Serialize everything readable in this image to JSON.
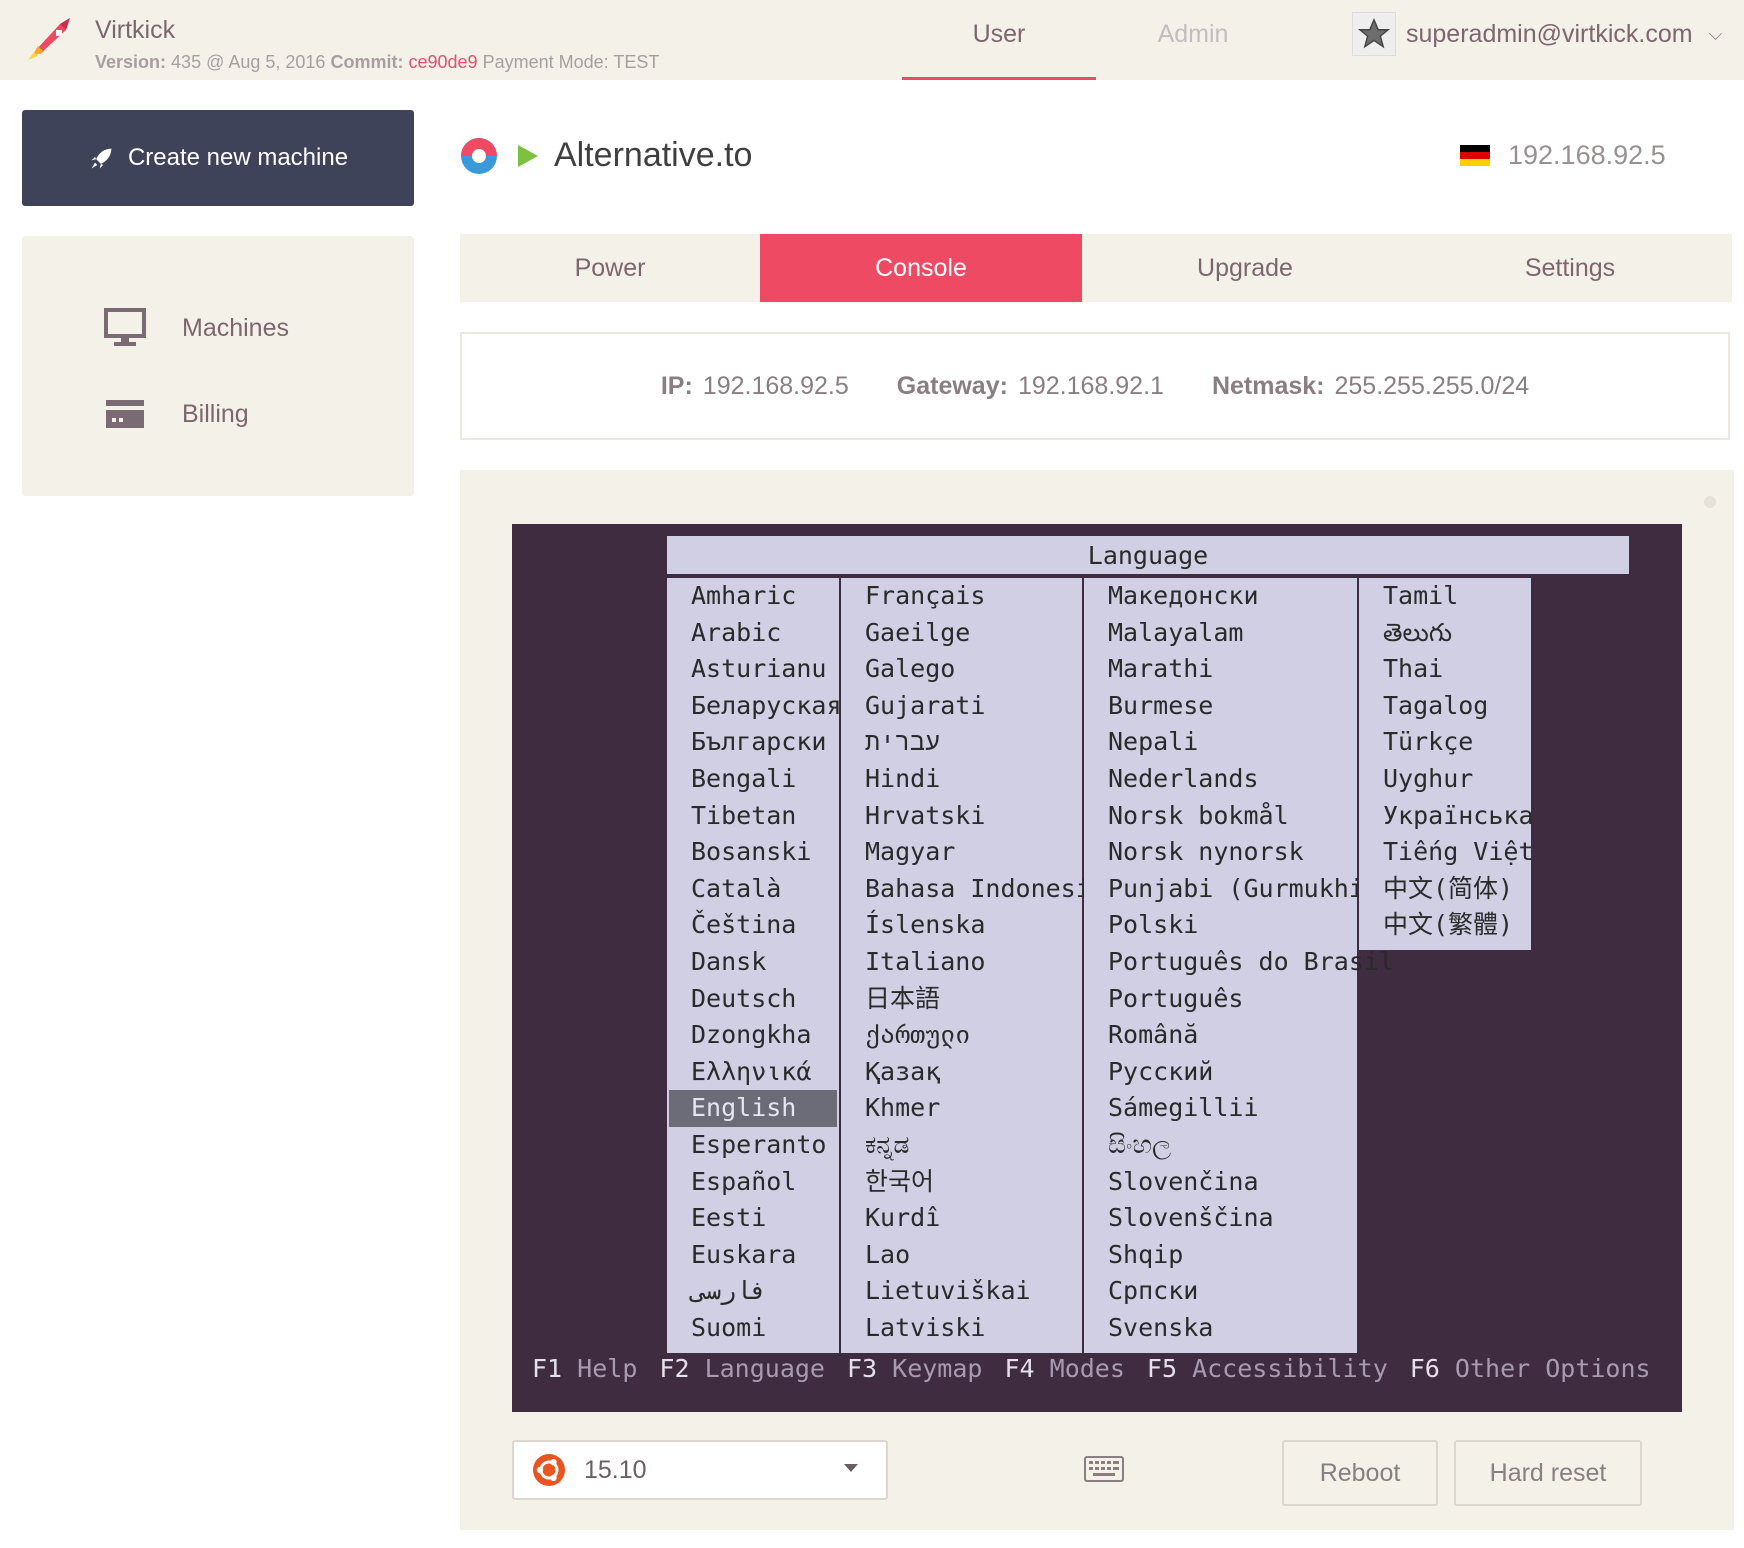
{
  "header": {
    "brand": "Virtkick",
    "version_label": "Version:",
    "version_value": "435 @ Aug 5, 2016",
    "commit_label": "Commit:",
    "commit_value": "ce90de9",
    "payment_label": "Payment Mode:",
    "payment_value": "TEST",
    "nav": [
      {
        "label": "User",
        "active": true
      },
      {
        "label": "Admin",
        "active": false
      }
    ],
    "user_email": "superadmin@virtkick.com"
  },
  "sidebar": {
    "create_label": "Create new machine",
    "items": [
      {
        "label": "Machines",
        "icon": "monitor-icon"
      },
      {
        "label": "Billing",
        "icon": "credit-card-icon"
      }
    ]
  },
  "machine": {
    "name": "Alternative.to",
    "ip": "192.168.92.5",
    "status_color": "#7dc142"
  },
  "tabs": [
    {
      "label": "Power",
      "active": false
    },
    {
      "label": "Console",
      "active": true
    },
    {
      "label": "Upgrade",
      "active": false
    },
    {
      "label": "Settings",
      "active": false
    }
  ],
  "network": {
    "ip_label": "IP:",
    "ip_value": "192.168.92.5",
    "gateway_label": "Gateway:",
    "gateway_value": "192.168.92.1",
    "netmask_label": "Netmask:",
    "netmask_value": "255.255.255.0/24"
  },
  "console": {
    "title": "Language",
    "selected": "English",
    "columns": [
      [
        "Amharic",
        "Arabic",
        "Asturianu",
        "Беларуская",
        "Български",
        "Bengali",
        "Tibetan",
        "Bosanski",
        "Català",
        "Čeština",
        "Dansk",
        "Deutsch",
        "Dzongkha",
        "Ελληνικά",
        "English",
        "Esperanto",
        "Español",
        "Eesti",
        "Euskara",
        "فارسی",
        "Suomi"
      ],
      [
        "Français",
        "Gaeilge",
        "Galego",
        "Gujarati",
        "עברית",
        "Hindi",
        "Hrvatski",
        "Magyar",
        "Bahasa Indonesia",
        "Íslenska",
        "Italiano",
        "日本語",
        "ქართული",
        "Қазақ",
        "Khmer",
        "ಕನ್ನಡ",
        "한국어",
        "Kurdî",
        "Lao",
        "Lietuviškai",
        "Latviski"
      ],
      [
        "Македонски",
        "Malayalam",
        "Marathi",
        "Burmese",
        "Nepali",
        "Nederlands",
        "Norsk bokmål",
        "Norsk nynorsk",
        "Punjabi (Gurmukhi)",
        "Polski",
        "Português do Brasil",
        "Português",
        "Română",
        "Русский",
        "Sámegillii",
        "සිංහල",
        "Slovenčina",
        "Slovenščina",
        "Shqip",
        "Српски",
        "Svenska"
      ],
      [
        "Tamil",
        "తెలుగు",
        "Thai",
        "Tagalog",
        "Türkçe",
        "Uyghur",
        "Українська",
        "Tiếng Việt",
        "中文(简体)",
        "中文(繁體)"
      ]
    ],
    "fkeys": [
      {
        "key": "F1",
        "label": "Help"
      },
      {
        "key": "F2",
        "label": "Language"
      },
      {
        "key": "F3",
        "label": "Keymap"
      },
      {
        "key": "F4",
        "label": "Modes"
      },
      {
        "key": "F5",
        "label": "Accessibility"
      },
      {
        "key": "F6",
        "label": "Other Options"
      }
    ]
  },
  "controls": {
    "os_version": "15.10",
    "reboot_label": "Reboot",
    "hard_reset_label": "Hard reset"
  },
  "colors": {
    "accent": "#ef4a63",
    "sidebar_button": "#3f4359",
    "panel_bg": "#f4f1e8",
    "console_bg": "#3f2c40",
    "menu_bg": "#d0cfe4"
  }
}
